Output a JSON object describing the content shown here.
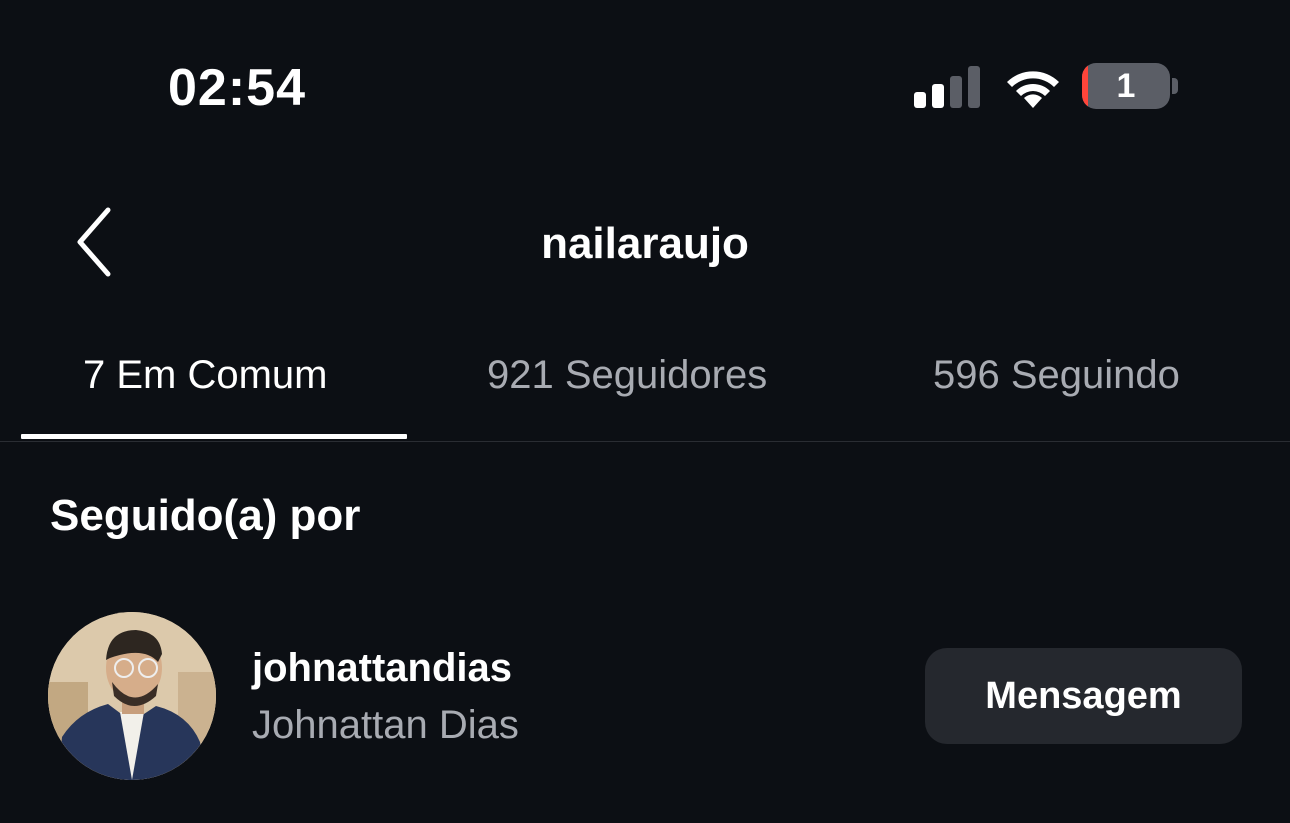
{
  "status_bar": {
    "time": "02:54",
    "battery_text": "1",
    "battery_level": 0.01,
    "signal_bars_active": 2,
    "signal_bars_total": 4,
    "wifi": "wifi-icon",
    "colors": {
      "battery_low": "#ff453a",
      "battery_body": "#5b5e66"
    }
  },
  "header": {
    "title": "nailaraujo",
    "back_icon": "chevron-left-icon"
  },
  "tabs": [
    {
      "label": "7 Em Comum",
      "active": true
    },
    {
      "label": "921 Seguidores",
      "active": false
    },
    {
      "label": "596 Seguindo",
      "active": false
    }
  ],
  "section": {
    "title": "Seguido(a) por"
  },
  "users": [
    {
      "username": "johnattandias",
      "full_name": "Johnattan Dias",
      "action_label": "Mensagem"
    }
  ],
  "colors": {
    "background": "#0c0f14",
    "text_primary": "#ffffff",
    "text_secondary": "#a8abb2",
    "button_bg": "#25282e",
    "divider": "#2a2d33"
  }
}
